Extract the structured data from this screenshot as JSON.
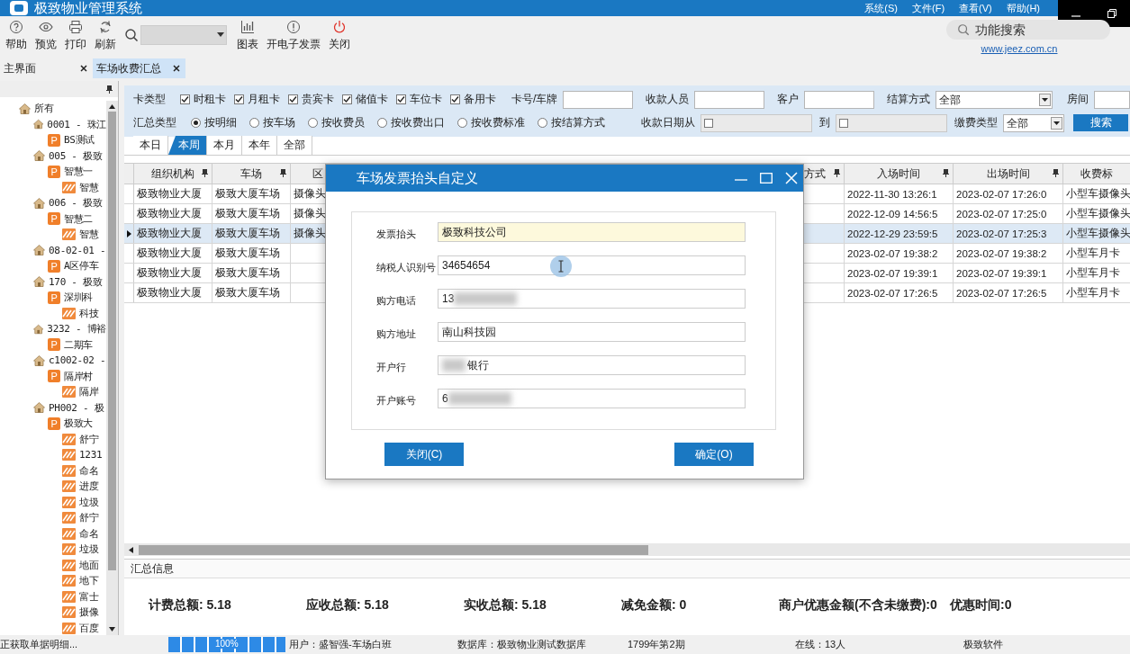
{
  "app_title": "极致物业管理系统",
  "menu": [
    "系统(S)",
    "文件(F)",
    "查看(V)",
    "帮助(H)"
  ],
  "toolbar": [
    {
      "kind": "help",
      "label": "帮助"
    },
    {
      "kind": "preview",
      "label": "预览"
    },
    {
      "kind": "print",
      "label": "打印"
    },
    {
      "kind": "refresh",
      "label": "刷新"
    },
    {
      "kind": "search-combo"
    },
    {
      "kind": "chart",
      "label": "图表"
    },
    {
      "kind": "invoice",
      "label": "开电子发票"
    },
    {
      "kind": "close",
      "label": "关闭"
    }
  ],
  "feature_search": {
    "placeholder": "功能搜索"
  },
  "website": "www.jeez.com.cn",
  "doc_tabs": [
    {
      "label": "主界面",
      "selected": false
    },
    {
      "label": "车场收费汇总",
      "selected": true
    }
  ],
  "tree": [
    {
      "label": "所有",
      "kind": "org",
      "children": [
        {
          "label": "0001 - 珠江",
          "kind": "org",
          "children": [
            {
              "label": "BS测试",
              "kind": "parking",
              "badge": "P"
            }
          ]
        },
        {
          "label": "005 - 极致",
          "kind": "org",
          "children": [
            {
              "label": "智慧一",
              "kind": "parking",
              "badge": "P",
              "children": [
                {
                  "label": "智慧",
                  "kind": "zone"
                }
              ]
            }
          ]
        },
        {
          "label": "006 - 极致",
          "kind": "org",
          "children": [
            {
              "label": "智慧二",
              "kind": "parking",
              "badge": "P",
              "children": [
                {
                  "label": "智慧",
                  "kind": "zone"
                }
              ]
            }
          ]
        },
        {
          "label": "08-02-01 -",
          "kind": "org",
          "children": [
            {
              "label": "A区停车",
              "kind": "parking",
              "badge": "P"
            }
          ]
        },
        {
          "label": "170 - 极致",
          "kind": "org",
          "children": [
            {
              "label": "深圳科",
              "kind": "parking",
              "badge": "P",
              "children": [
                {
                  "label": "科技",
                  "kind": "zone"
                }
              ]
            }
          ]
        },
        {
          "label": "3232 - 博裕",
          "kind": "org",
          "children": [
            {
              "label": "二期车",
              "kind": "parking",
              "badge": "P"
            }
          ]
        },
        {
          "label": "c1002-02 -",
          "kind": "org",
          "children": [
            {
              "label": "隔岸村",
              "kind": "parking",
              "badge": "P",
              "children": [
                {
                  "label": "隔岸",
                  "kind": "zone"
                }
              ]
            }
          ]
        },
        {
          "label": "PH002 - 极",
          "kind": "org",
          "children": [
            {
              "label": "极致大",
              "kind": "parking",
              "badge": "P",
              "children": [
                {
                  "label": "舒宁",
                  "kind": "zone"
                },
                {
                  "label": "1231",
                  "kind": "zone"
                },
                {
                  "label": "命名",
                  "kind": "zone"
                },
                {
                  "label": "进度",
                  "kind": "zone"
                },
                {
                  "label": "垃圾",
                  "kind": "zone"
                },
                {
                  "label": "舒宁",
                  "kind": "zone"
                },
                {
                  "label": "命名",
                  "kind": "zone"
                },
                {
                  "label": "垃圾",
                  "kind": "zone"
                },
                {
                  "label": "地面",
                  "kind": "zone"
                },
                {
                  "label": "地下",
                  "kind": "zone"
                },
                {
                  "label": "富士",
                  "kind": "zone"
                },
                {
                  "label": "摄像",
                  "kind": "zone"
                },
                {
                  "label": "百度",
                  "kind": "zone"
                }
              ]
            }
          ]
        }
      ]
    }
  ],
  "filters": [
    [
      {
        "kind": "label",
        "text": "卡类型"
      },
      {
        "kind": "check",
        "text": "时租卡",
        "checked": true
      },
      {
        "kind": "check",
        "text": "月租卡",
        "checked": true
      },
      {
        "kind": "check",
        "text": "贵宾卡",
        "checked": true
      },
      {
        "kind": "check",
        "text": "储值卡",
        "checked": true
      },
      {
        "kind": "check",
        "text": "车位卡",
        "checked": true
      },
      {
        "kind": "check",
        "text": "备用卡",
        "checked": true
      },
      {
        "kind": "label",
        "text": "卡号/车牌"
      },
      {
        "kind": "input"
      },
      {
        "kind": "label",
        "text": "收款人员"
      },
      {
        "kind": "input"
      },
      {
        "kind": "label",
        "text": "客户"
      },
      {
        "kind": "input"
      },
      {
        "kind": "label",
        "text": "结算方式"
      },
      {
        "kind": "select",
        "text": "全部"
      },
      {
        "kind": "label",
        "text": "房间"
      },
      {
        "kind": "input"
      }
    ],
    [
      {
        "kind": "label",
        "text": "汇总类型"
      },
      {
        "kind": "radio",
        "text": "按明细",
        "selected": true
      },
      {
        "kind": "radio",
        "text": "按车场",
        "selected": false
      },
      {
        "kind": "radio",
        "text": "按收费员",
        "selected": false
      },
      {
        "kind": "radio",
        "text": "按收费出口",
        "selected": false
      },
      {
        "kind": "radio",
        "text": "按收费标准",
        "selected": false
      },
      {
        "kind": "radio",
        "text": "按结算方式",
        "selected": false
      },
      {
        "kind": "label",
        "text": "收款日期从"
      },
      {
        "kind": "date",
        "checked": false
      },
      {
        "kind": "label",
        "text": "到"
      },
      {
        "kind": "date",
        "checked": false
      },
      {
        "kind": "label",
        "text": "缴费类型"
      },
      {
        "kind": "select",
        "text": "全部"
      },
      {
        "kind": "button",
        "text": "搜索"
      }
    ]
  ],
  "period_tabs": [
    {
      "label": "本日",
      "selected": false
    },
    {
      "label": "本周",
      "selected": true
    },
    {
      "label": "本月",
      "selected": false
    },
    {
      "label": "本年",
      "selected": false
    },
    {
      "label": "全部",
      "selected": false
    }
  ],
  "table": {
    "columns": [
      "组织机构",
      "车场",
      "区",
      "方式",
      "入场时间",
      "出场时间",
      "收费标"
    ],
    "rows": [
      {
        "selected": false,
        "org": "极致物业大厦",
        "lot": "极致大厦车场",
        "area": "摄像头",
        "entry": "2022-11-30 13:26:1",
        "exit": "2023-02-07 17:26:0",
        "fee_standard": "小型车摄像头"
      },
      {
        "selected": false,
        "org": "极致物业大厦",
        "lot": "极致大厦车场",
        "area": "摄像头",
        "entry": "2022-12-09 14:56:5",
        "exit": "2023-02-07 17:25:0",
        "fee_standard": "小型车摄像头"
      },
      {
        "selected": true,
        "org": "极致物业大厦",
        "lot": "极致大厦车场",
        "area": "摄像头",
        "entry": "2022-12-29 23:59:5",
        "exit": "2023-02-07 17:25:3",
        "fee_standard": "小型车摄像头"
      },
      {
        "selected": false,
        "org": "极致物业大厦",
        "lot": "极致大厦车场",
        "entry": "2023-02-07 19:38:2",
        "exit": "2023-02-07 19:38:2",
        "fee_standard": "小型车月卡"
      },
      {
        "selected": false,
        "org": "极致物业大厦",
        "lot": "极致大厦车场",
        "entry": "2023-02-07 19:39:1",
        "exit": "2023-02-07 19:39:1",
        "fee_standard": "小型车月卡"
      },
      {
        "selected": false,
        "org": "极致物业大厦",
        "lot": "极致大厦车场",
        "entry": "2023-02-07 17:26:5",
        "exit": "2023-02-07 17:26:5",
        "fee_standard": "小型车月卡"
      }
    ]
  },
  "summary": {
    "title": "汇总信息",
    "items": [
      "计费总额: 5.18",
      "应收总额: 5.18",
      "实收总额: 5.18",
      "减免金额: 0",
      "商户优惠金额(不含未缴费):0",
      "优惠时间:0"
    ]
  },
  "status_bar": {
    "message": "正获取单据明细...",
    "progress": {
      "level": 1,
      "label": "100%"
    },
    "user": "用户：盛智强-车场白班",
    "database": "数据库：极致物业测试数据库",
    "period": "1799年第2期",
    "online": "在线：13人",
    "vendor": "极致软件"
  },
  "dialog": {
    "title": "车场发票抬头自定义",
    "fields": [
      {
        "label": "发票抬头",
        "value": "极致科技公司",
        "highlighted": true,
        "redacted": false
      },
      {
        "label": "纳税人识别号",
        "value": "34654654",
        "highlighted": false,
        "redacted": false,
        "cursor": true
      },
      {
        "label": "购方电话",
        "value": "13",
        "highlighted": false,
        "redacted": true
      },
      {
        "label": "购方地址",
        "value": "南山科技园",
        "highlighted": false,
        "redacted": false
      },
      {
        "label": "开户行",
        "value": "银行",
        "highlighted": false,
        "redacted": true,
        "blur_first": true
      },
      {
        "label": "开户账号",
        "value": "6",
        "highlighted": false,
        "redacted": true
      }
    ],
    "buttons": [
      "关闭(C)",
      "确定(O)"
    ]
  }
}
